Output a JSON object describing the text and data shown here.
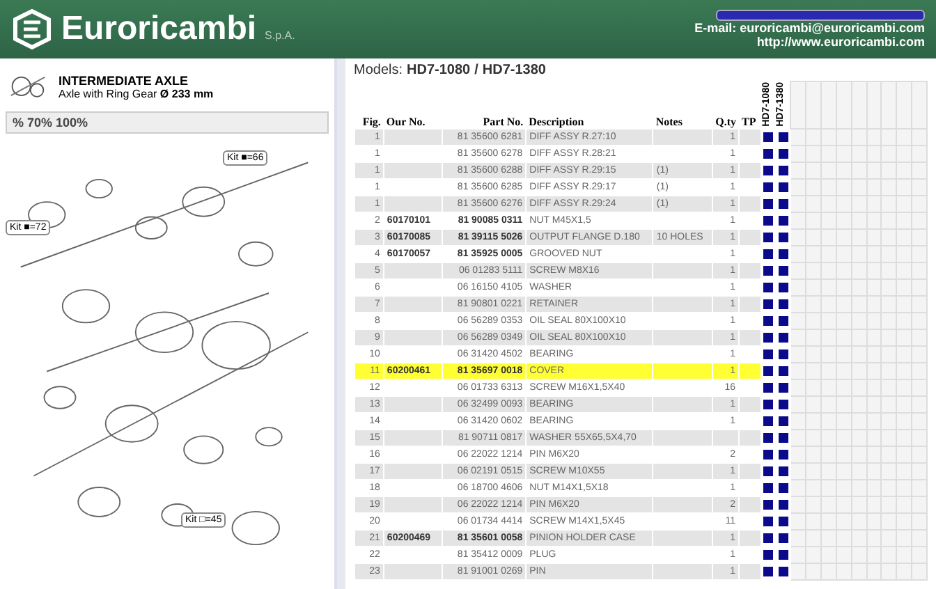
{
  "header": {
    "brand": "Euroricambi",
    "suffix": "S.p.A.",
    "email": "E-mail: euroricambi@euroricambi.com",
    "website": "http://www.euroricambi.com"
  },
  "group": {
    "title": "INTERMEDIATE AXLE",
    "subtitle": "Axle with Ring Gear **Ø 233 mm**",
    "zoom": "% 70% 100%",
    "kits": [
      "Kit ■=72",
      "Kit ■=66",
      "Kit □=45"
    ]
  },
  "models_title": "Models:",
  "title_models": [
    "HD7-1080",
    "/",
    "HD7-1380"
  ],
  "models": [
    "HD7-1080",
    "HD7-1380"
  ],
  "columns": [
    "Fig.",
    "Our No.",
    "Part No.",
    "Description",
    "Notes",
    "Q.ty",
    "TP"
  ],
  "rows": [
    {
      "fig": "1",
      "our_no": "",
      "part_no": "81 35600 6281",
      "description": "DIFF ASSY R.27:10",
      "notes": "",
      "qty": "1",
      "selected": false,
      "models": [
        true,
        true
      ]
    },
    {
      "fig": "1",
      "our_no": "",
      "part_no": "81 35600 6278",
      "description": "DIFF ASSY R.28:21",
      "notes": "",
      "qty": "1",
      "selected": false,
      "models": [
        true,
        true
      ]
    },
    {
      "fig": "1",
      "our_no": "",
      "part_no": "81 35600 6288",
      "description": "DIFF ASSY R.29:15",
      "notes": "(1)",
      "qty": "1",
      "selected": false,
      "models": [
        true,
        true
      ]
    },
    {
      "fig": "1",
      "our_no": "",
      "part_no": "81 35600 6285",
      "description": "DIFF ASSY R.29:17",
      "notes": "(1)",
      "qty": "1",
      "selected": false,
      "models": [
        true,
        true
      ]
    },
    {
      "fig": "1",
      "our_no": "",
      "part_no": "81 35600 6276",
      "description": "DIFF ASSY R.29:24",
      "notes": "(1)",
      "qty": "1",
      "selected": false,
      "models": [
        true,
        true
      ]
    },
    {
      "fig": "2",
      "our_no": "60170101",
      "part_no": "81 90085 0311",
      "description": "NUT M45X1,5",
      "notes": "",
      "qty": "1",
      "selected": false,
      "models": [
        true,
        true
      ]
    },
    {
      "fig": "3",
      "our_no": "60170085",
      "part_no": "81 39115 5026",
      "description": "OUTPUT FLANGE D.180",
      "notes": "10 HOLES",
      "qty": "1",
      "selected": false,
      "models": [
        true,
        true
      ]
    },
    {
      "fig": "4",
      "our_no": "60170057",
      "part_no": "81 35925 0005",
      "description": "GROOVED NUT",
      "notes": "",
      "qty": "1",
      "selected": false,
      "models": [
        true,
        true
      ]
    },
    {
      "fig": "5",
      "our_no": "",
      "part_no": "06 01283 5111",
      "description": "SCREW M8X16",
      "notes": "",
      "qty": "1",
      "selected": false,
      "models": [
        true,
        true
      ]
    },
    {
      "fig": "6",
      "our_no": "",
      "part_no": "06 16150 4105",
      "description": "WASHER",
      "notes": "",
      "qty": "1",
      "selected": false,
      "models": [
        true,
        true
      ]
    },
    {
      "fig": "7",
      "our_no": "",
      "part_no": "81 90801 0221",
      "description": "RETAINER",
      "notes": "",
      "qty": "1",
      "selected": false,
      "models": [
        true,
        true
      ]
    },
    {
      "fig": "8",
      "our_no": "",
      "part_no": "06 56289 0353",
      "description": "OIL SEAL 80X100X10",
      "notes": "",
      "qty": "1",
      "selected": false,
      "models": [
        true,
        true
      ]
    },
    {
      "fig": "9",
      "our_no": "",
      "part_no": "06 56289 0349",
      "description": "OIL SEAL 80X100X10",
      "notes": "",
      "qty": "1",
      "selected": false,
      "models": [
        true,
        true
      ]
    },
    {
      "fig": "10",
      "our_no": "",
      "part_no": "06 31420 4502",
      "description": "BEARING",
      "notes": "",
      "qty": "1",
      "selected": false,
      "models": [
        true,
        true
      ]
    },
    {
      "fig": "11",
      "our_no": "60200461",
      "part_no": "81 35697 0018",
      "description": "COVER",
      "notes": "",
      "qty": "1",
      "selected": true,
      "models": [
        true,
        true
      ]
    },
    {
      "fig": "12",
      "our_no": "",
      "part_no": "06 01733 6313",
      "description": "SCREW M16X1,5X40",
      "notes": "",
      "qty": "16",
      "selected": false,
      "models": [
        true,
        true
      ]
    },
    {
      "fig": "13",
      "our_no": "",
      "part_no": "06 32499 0093",
      "description": "BEARING",
      "notes": "",
      "qty": "1",
      "selected": false,
      "models": [
        true,
        true
      ]
    },
    {
      "fig": "14",
      "our_no": "",
      "part_no": "06 31420 0602",
      "description": "BEARING",
      "notes": "",
      "qty": "1",
      "selected": false,
      "models": [
        true,
        true
      ]
    },
    {
      "fig": "15",
      "our_no": "",
      "part_no": "81 90711 0817",
      "description": "WASHER 55X65,5X4,70",
      "notes": "",
      "qty": "",
      "selected": false,
      "models": [
        true,
        true
      ]
    },
    {
      "fig": "16",
      "our_no": "",
      "part_no": "06 22022 1214",
      "description": "PIN M6X20",
      "notes": "",
      "qty": "2",
      "selected": false,
      "models": [
        true,
        true
      ]
    },
    {
      "fig": "17",
      "our_no": "",
      "part_no": "06 02191 0515",
      "description": "SCREW M10X55",
      "notes": "",
      "qty": "1",
      "selected": false,
      "models": [
        true,
        true
      ]
    },
    {
      "fig": "18",
      "our_no": "",
      "part_no": "06 18700 4606",
      "description": "NUT M14X1,5X18",
      "notes": "",
      "qty": "1",
      "selected": false,
      "models": [
        true,
        true
      ]
    },
    {
      "fig": "19",
      "our_no": "",
      "part_no": "06 22022 1214",
      "description": "PIN M6X20",
      "notes": "",
      "qty": "2",
      "selected": false,
      "models": [
        true,
        true
      ]
    },
    {
      "fig": "20",
      "our_no": "",
      "part_no": "06 01734 4414",
      "description": "SCREW M14X1,5X45",
      "notes": "",
      "qty": "11",
      "selected": false,
      "models": [
        true,
        true
      ]
    },
    {
      "fig": "21",
      "our_no": "60200469",
      "part_no": "81 35601 0058",
      "description": "PINION HOLDER CASE",
      "notes": "",
      "qty": "1",
      "selected": false,
      "models": [
        true,
        true
      ]
    },
    {
      "fig": "22",
      "our_no": "",
      "part_no": "81 35412 0009",
      "description": "PLUG",
      "notes": "",
      "qty": "1",
      "selected": false,
      "models": [
        true,
        true
      ]
    },
    {
      "fig": "23",
      "our_no": "",
      "part_no": "81 91001 0269",
      "description": "PIN",
      "notes": "",
      "qty": "1",
      "selected": false,
      "models": [
        true,
        true
      ]
    }
  ]
}
